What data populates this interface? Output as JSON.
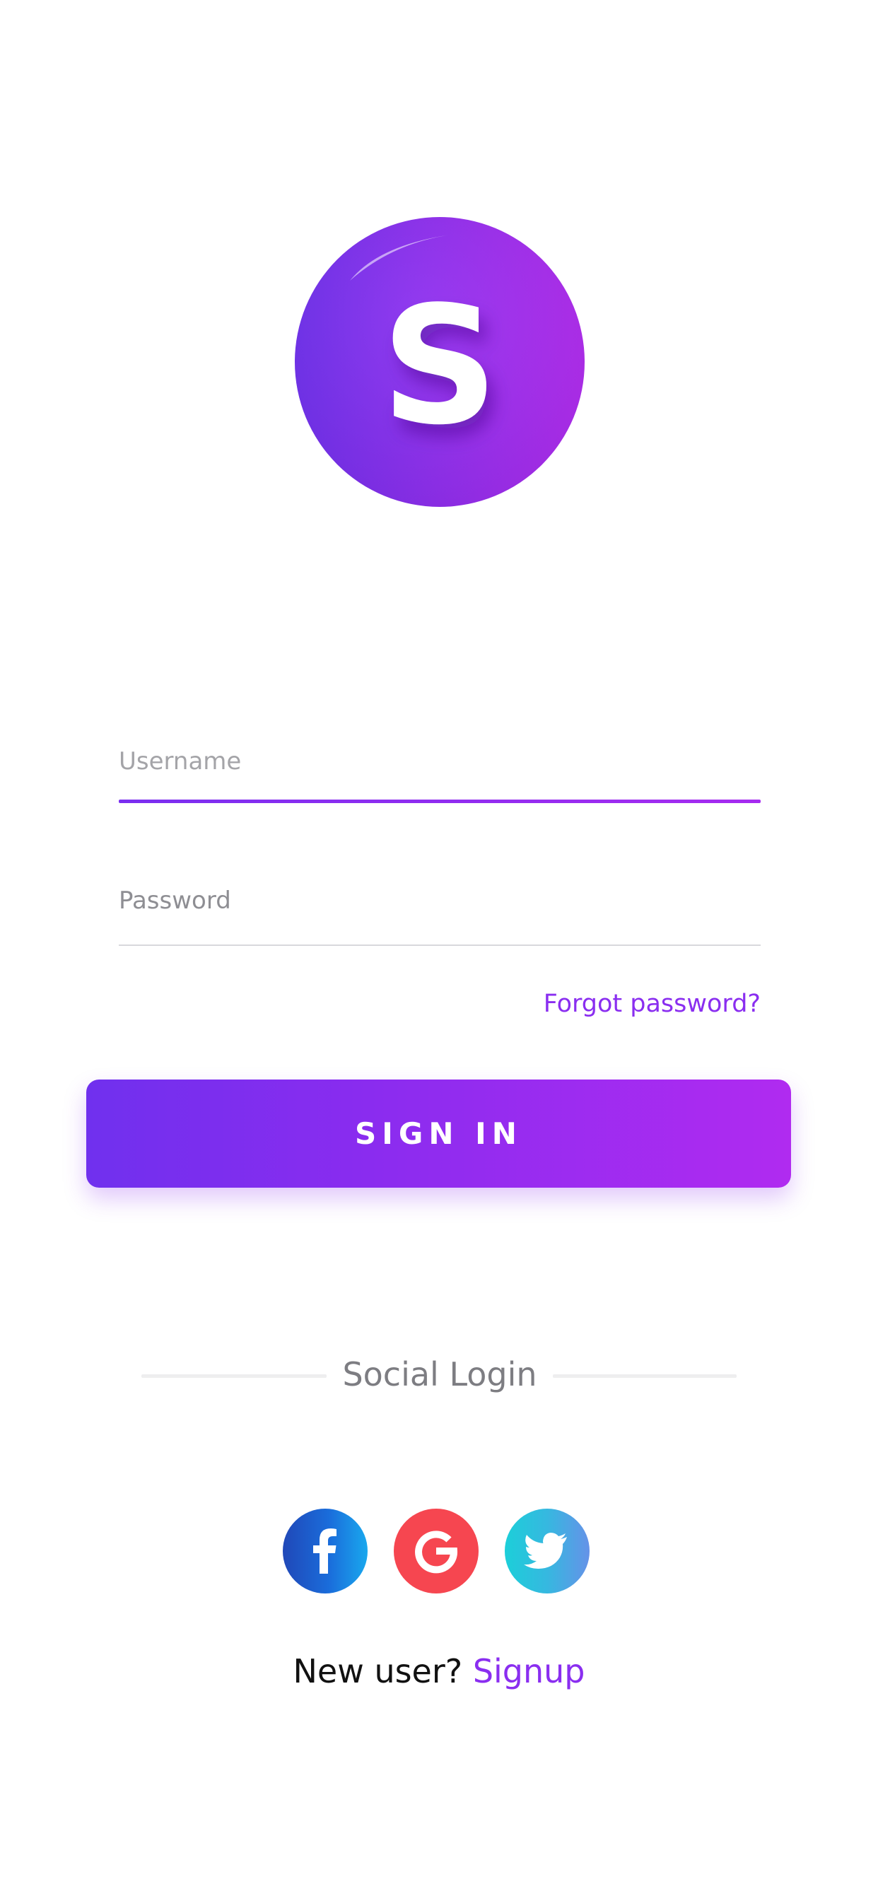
{
  "app": {
    "logo_letter": "S"
  },
  "form": {
    "username": {
      "placeholder": "Username",
      "value": ""
    },
    "password": {
      "placeholder": "Password",
      "value": ""
    },
    "forgot_password_label": "Forgot password?",
    "sign_in_label": "SIGN IN"
  },
  "social": {
    "title": "Social Login",
    "buttons": [
      {
        "name": "Facebook",
        "icon": "facebook-icon"
      },
      {
        "name": "Google",
        "icon": "google-icon"
      },
      {
        "name": "Twitter",
        "icon": "twitter-icon"
      }
    ]
  },
  "signup": {
    "prompt": "New user?",
    "link_label": "Signup"
  },
  "colors": {
    "accent": "#8a2ef0",
    "gradient_start": "#7030ee",
    "gradient_end": "#b02bf0",
    "facebook": "#1a6ddb",
    "google": "#f64650",
    "twitter": "#36b8e0",
    "placeholder": "#a4a4a8"
  }
}
